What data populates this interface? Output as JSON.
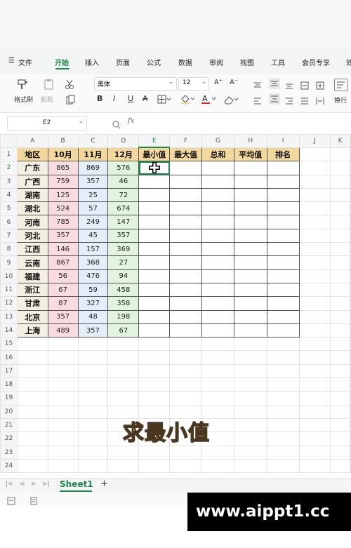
{
  "menu": {
    "file_icon": "☰",
    "file": "文件",
    "tabs": [
      "开始",
      "插入",
      "页面",
      "公式",
      "数据",
      "审阅",
      "视图",
      "工具",
      "会员专享",
      "效"
    ]
  },
  "ribbon": {
    "format_painter": "格式刷",
    "paste": "粘贴",
    "font_name": "黑体",
    "font_size": "12",
    "wrap": "换行",
    "bold": "B",
    "italic": "I",
    "underline": "U",
    "strike": "A",
    "grow": "A⁺",
    "shrink": "A⁻"
  },
  "formula_bar": {
    "cell_ref": "E2",
    "fx": "fx",
    "zoom_icon": "zoom-icon"
  },
  "sheet": {
    "columns": [
      "A",
      "B",
      "C",
      "D",
      "E",
      "F",
      "G",
      "H",
      "I",
      "J",
      "K"
    ],
    "row_numbers": [
      "1",
      "2",
      "3",
      "4",
      "5",
      "6",
      "7",
      "8",
      "9",
      "10",
      "11",
      "12",
      "13",
      "14",
      "15",
      "16",
      "17",
      "18",
      "19",
      "20",
      "21",
      "22",
      "23",
      "24"
    ],
    "headers": [
      "地区",
      "10月",
      "11月",
      "12月",
      "最小值",
      "最大值",
      "总和",
      "平均值",
      "排名"
    ],
    "rows": [
      [
        "广东",
        "865",
        "869",
        "576"
      ],
      [
        "广西",
        "759",
        "357",
        "46"
      ],
      [
        "湖南",
        "125",
        "25",
        "72"
      ],
      [
        "湖北",
        "524",
        "57",
        "674"
      ],
      [
        "河南",
        "785",
        "249",
        "147"
      ],
      [
        "河北",
        "357",
        "45",
        "357"
      ],
      [
        "江西",
        "146",
        "157",
        "369"
      ],
      [
        "云南",
        "867",
        "368",
        "27"
      ],
      [
        "福建",
        "56",
        "476",
        "94"
      ],
      [
        "浙江",
        "67",
        "59",
        "458"
      ],
      [
        "甘肃",
        "87",
        "327",
        "358"
      ],
      [
        "北京",
        "357",
        "48",
        "198"
      ],
      [
        "上海",
        "489",
        "357",
        "67"
      ]
    ],
    "selected_cell": "E2"
  },
  "caption": "求最小值",
  "sheet_tabs": {
    "nav": [
      "|<",
      "<",
      ">",
      ">|"
    ],
    "active": "Sheet1",
    "add": "+"
  },
  "watermark": "www.aippt1.cc",
  "colors": {
    "accent": "#1a8a4a",
    "header_fill": "#f2d89c",
    "oct_fill": "#f9dce0",
    "nov_fill": "#e3eef8",
    "dec_fill": "#e2f4de"
  }
}
